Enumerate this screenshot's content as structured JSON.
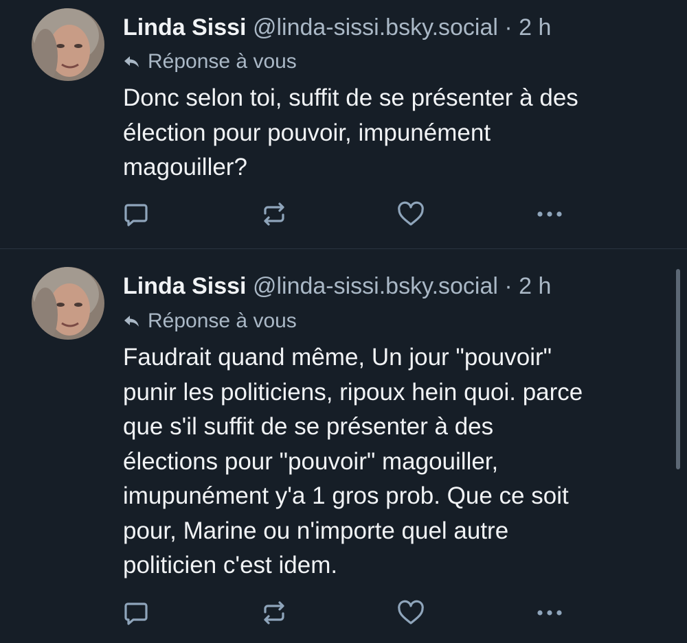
{
  "colors": {
    "background": "#161e27",
    "text_primary": "#f1f3f5",
    "text_secondary": "#aab8c6",
    "divider": "#2a3440",
    "icon": "#8fa5bb"
  },
  "posts": [
    {
      "author_name": "Linda Sissi",
      "handle": "@linda-sissi.bsky.social",
      "separator": "·",
      "time": "2 h",
      "reply_icon": "reply-arrow-icon",
      "reply_label": "Réponse à vous",
      "text_lines": [
        "Donc selon toi, suffit de se présenter à des",
        "élection pour pouvoir, impunément",
        "magouiller?"
      ],
      "actions": [
        "comment-icon",
        "repost-icon",
        "heart-icon",
        "more-icon"
      ]
    },
    {
      "author_name": "Linda Sissi",
      "handle": "@linda-sissi.bsky.social",
      "separator": "·",
      "time": "2 h",
      "reply_icon": "reply-arrow-icon",
      "reply_label": "Réponse à vous",
      "text_lines": [
        "Faudrait quand même, Un jour \"pouvoir\"",
        "punir les politiciens, ripoux hein quoi. parce",
        "que s'il suffit de se présenter à des",
        "élections pour \"pouvoir\" magouiller,",
        "imupunément y'a 1 gros prob. Que ce soit",
        "pour, Marine ou n'importe quel autre",
        "politicien c'est idem."
      ],
      "actions": [
        "comment-icon",
        "repost-icon",
        "heart-icon",
        "more-icon"
      ]
    }
  ]
}
